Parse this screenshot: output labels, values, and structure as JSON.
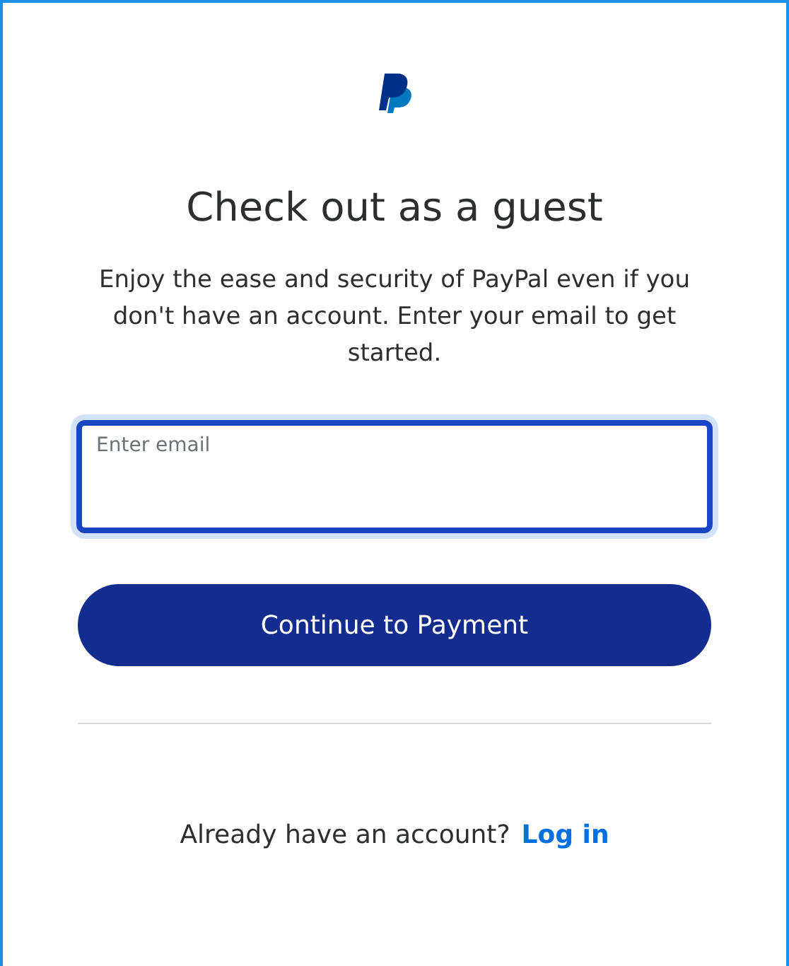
{
  "title": "Check out as a guest",
  "description": "Enjoy the ease and security of PayPal even if you don't have an account. Enter your email to get started.",
  "email_field": {
    "placeholder": "Enter email",
    "focused": true
  },
  "continue_button": {
    "label": "Continue to Payment"
  },
  "login_prompt": {
    "text": "Already have an account?",
    "link": "Log in"
  }
}
